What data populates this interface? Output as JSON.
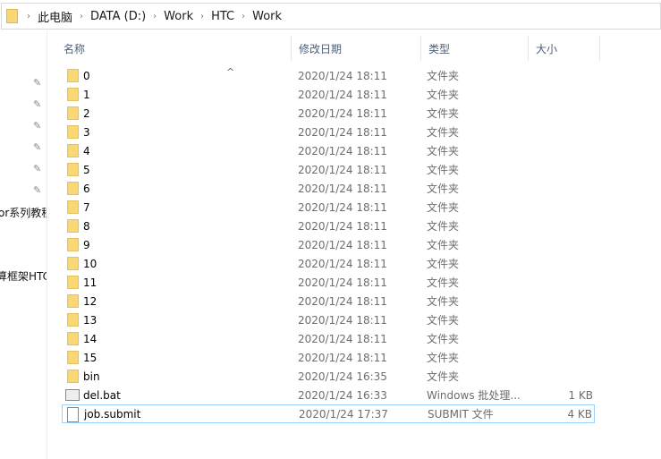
{
  "address": {
    "crumbs": [
      "此电脑",
      "DATA (D:)",
      "Work",
      "HTC",
      "Work"
    ]
  },
  "nav": {
    "pins": 7,
    "items": [
      "or系列教程",
      "算框架HTC"
    ]
  },
  "columns": {
    "name": "名称",
    "date": "修改日期",
    "type": "类型",
    "size": "大小"
  },
  "files": [
    {
      "name": "0",
      "date": "2020/1/24 18:11",
      "type": "文件夹",
      "size": "",
      "icon": "folder"
    },
    {
      "name": "1",
      "date": "2020/1/24 18:11",
      "type": "文件夹",
      "size": "",
      "icon": "folder"
    },
    {
      "name": "2",
      "date": "2020/1/24 18:11",
      "type": "文件夹",
      "size": "",
      "icon": "folder"
    },
    {
      "name": "3",
      "date": "2020/1/24 18:11",
      "type": "文件夹",
      "size": "",
      "icon": "folder"
    },
    {
      "name": "4",
      "date": "2020/1/24 18:11",
      "type": "文件夹",
      "size": "",
      "icon": "folder"
    },
    {
      "name": "5",
      "date": "2020/1/24 18:11",
      "type": "文件夹",
      "size": "",
      "icon": "folder"
    },
    {
      "name": "6",
      "date": "2020/1/24 18:11",
      "type": "文件夹",
      "size": "",
      "icon": "folder"
    },
    {
      "name": "7",
      "date": "2020/1/24 18:11",
      "type": "文件夹",
      "size": "",
      "icon": "folder"
    },
    {
      "name": "8",
      "date": "2020/1/24 18:11",
      "type": "文件夹",
      "size": "",
      "icon": "folder"
    },
    {
      "name": "9",
      "date": "2020/1/24 18:11",
      "type": "文件夹",
      "size": "",
      "icon": "folder"
    },
    {
      "name": "10",
      "date": "2020/1/24 18:11",
      "type": "文件夹",
      "size": "",
      "icon": "folder"
    },
    {
      "name": "11",
      "date": "2020/1/24 18:11",
      "type": "文件夹",
      "size": "",
      "icon": "folder"
    },
    {
      "name": "12",
      "date": "2020/1/24 18:11",
      "type": "文件夹",
      "size": "",
      "icon": "folder"
    },
    {
      "name": "13",
      "date": "2020/1/24 18:11",
      "type": "文件夹",
      "size": "",
      "icon": "folder"
    },
    {
      "name": "14",
      "date": "2020/1/24 18:11",
      "type": "文件夹",
      "size": "",
      "icon": "folder"
    },
    {
      "name": "15",
      "date": "2020/1/24 18:11",
      "type": "文件夹",
      "size": "",
      "icon": "folder"
    },
    {
      "name": "bin",
      "date": "2020/1/24 16:35",
      "type": "文件夹",
      "size": "",
      "icon": "folder"
    },
    {
      "name": "del.bat",
      "date": "2020/1/24 16:33",
      "type": "Windows 批处理...",
      "size": "1 KB",
      "icon": "bat"
    },
    {
      "name": "job.submit",
      "date": "2020/1/24 17:37",
      "type": "SUBMIT 文件",
      "size": "4 KB",
      "icon": "file",
      "selected": true
    }
  ]
}
